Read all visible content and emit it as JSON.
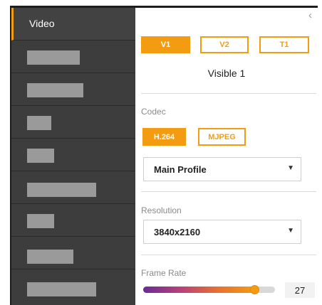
{
  "sidebar": {
    "active_label": "Video",
    "redacted_items": 8
  },
  "panel": {
    "collapse_glyph": "‹",
    "streams": [
      {
        "label": "V1",
        "selected": true
      },
      {
        "label": "V2",
        "selected": false
      },
      {
        "label": "T1",
        "selected": false
      }
    ],
    "stream_caption": "Visible 1",
    "codec": {
      "label": "Codec",
      "options": [
        {
          "label": "H.264",
          "selected": true
        },
        {
          "label": "MJPEG",
          "selected": false
        }
      ],
      "profile": "Main Profile"
    },
    "resolution": {
      "label": "Resolution",
      "value": "3840x2160"
    },
    "frame_rate": {
      "label": "Frame Rate",
      "value": "27",
      "fraction": 0.85
    }
  },
  "colors": {
    "accent": "#f39c12",
    "sidebar_bg": "#3d3d3d",
    "redaction": "#9a9a9a"
  }
}
